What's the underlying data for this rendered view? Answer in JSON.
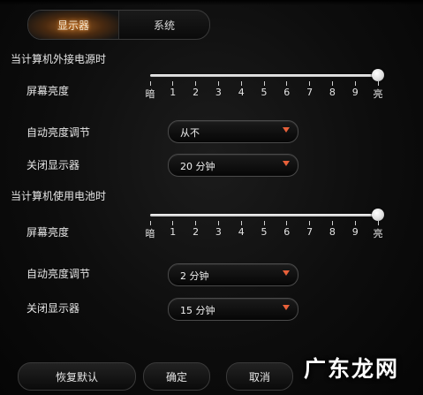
{
  "tabs": [
    {
      "label": "显示器",
      "active": true
    },
    {
      "label": "系统",
      "active": false
    }
  ],
  "ac": {
    "title": "当计算机外接电源时",
    "brightness_label": "屏幕亮度",
    "brightness_level": 10,
    "auto_brightness_label": "自动亮度调节",
    "auto_brightness_value": "从不",
    "turn_off_label": "关闭显示器",
    "turn_off_value": "20 分钟"
  },
  "battery": {
    "title": "当计算机使用电池时",
    "brightness_label": "屏幕亮度",
    "brightness_level": 10,
    "auto_brightness_label": "自动亮度调节",
    "auto_brightness_value": "2 分钟",
    "turn_off_label": "关闭显示器",
    "turn_off_value": "15 分钟"
  },
  "slider_ticks": [
    "暗",
    "1",
    "2",
    "3",
    "4",
    "5",
    "6",
    "7",
    "8",
    "9",
    "亮"
  ],
  "buttons": {
    "restore": "恢复默认",
    "ok": "确定",
    "cancel": "取消"
  },
  "watermark": "广东龙网",
  "colors": {
    "accent_tab": "#9a5a20",
    "dropdown_arrow": "#e8603a"
  },
  "icons": {
    "dropdown": "triangle-down-icon",
    "slider_thumb": "circle-knob"
  }
}
